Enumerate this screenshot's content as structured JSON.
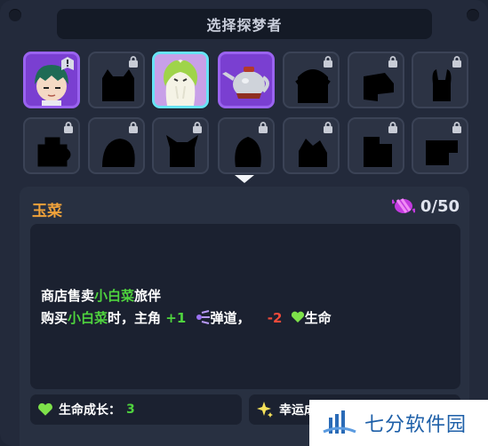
{
  "header": {
    "title": "选择探梦者"
  },
  "characters": [
    {
      "id": "char-1",
      "state": "unlocked-purple",
      "portrait": "green-hair-boy"
    },
    {
      "id": "char-2",
      "state": "locked",
      "silhouette": "cat"
    },
    {
      "id": "char-3",
      "state": "selected",
      "portrait": "cabbage"
    },
    {
      "id": "char-4",
      "state": "unlocked-purple",
      "portrait": "teapot"
    },
    {
      "id": "char-5",
      "state": "locked",
      "silhouette": "ghost"
    },
    {
      "id": "char-6",
      "state": "locked",
      "silhouette": "rocket"
    },
    {
      "id": "char-7",
      "state": "locked",
      "silhouette": "bunny"
    },
    {
      "id": "char-8",
      "state": "locked",
      "silhouette": "cup"
    },
    {
      "id": "char-9",
      "state": "locked",
      "silhouette": "blob"
    },
    {
      "id": "char-10",
      "state": "locked",
      "silhouette": "fox"
    },
    {
      "id": "char-11",
      "state": "locked",
      "silhouette": "egg"
    },
    {
      "id": "char-12",
      "state": "locked",
      "silhouette": "dog"
    },
    {
      "id": "char-13",
      "state": "locked",
      "silhouette": "pillar"
    },
    {
      "id": "char-14",
      "state": "locked",
      "silhouette": "block"
    }
  ],
  "detail": {
    "name": "玉菜",
    "count": "0/50",
    "line1": {
      "a": "商店售卖",
      "b": "小白菜",
      "c": "旅伴"
    },
    "line2": {
      "a": "购买",
      "b": "小白菜",
      "c": "时，主角 ",
      "d": "+1",
      "e": "弹道，",
      "f": "-2",
      "g": "生命"
    }
  },
  "stats": {
    "growth": "生命成长：",
    "growth_value": "3",
    "luck": "幸运成"
  },
  "watermark": {
    "text": "七分软件园"
  },
  "colors": {
    "accent_orange": "#f0a23a",
    "accent_green": "#4fd43e",
    "accent_red": "#f04a3a",
    "select_cyan": "#67e3f5"
  }
}
